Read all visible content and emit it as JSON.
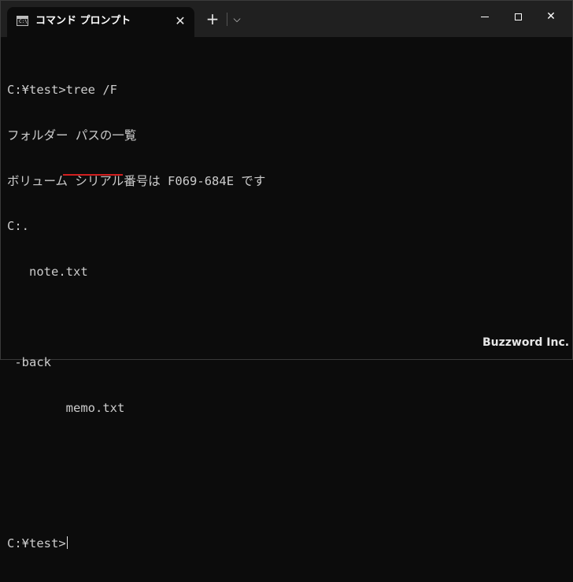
{
  "tab": {
    "icon_text": "C:\\",
    "title": "コマンド プロンプト",
    "close": "✕"
  },
  "toolbar": {
    "new_tab": "+",
    "dropdown": "⌵"
  },
  "window_controls": {
    "close": "✕"
  },
  "console": {
    "lines": [
      "C:¥test>tree /F",
      "フォルダー パスの一覧",
      "ボリューム シリアル番号は F069-684E です",
      "C:.",
      "   note.txt",
      "",
      " -back",
      "        memo.txt",
      "",
      "",
      "C:¥test>"
    ]
  },
  "watermark": "Buzzword Inc."
}
